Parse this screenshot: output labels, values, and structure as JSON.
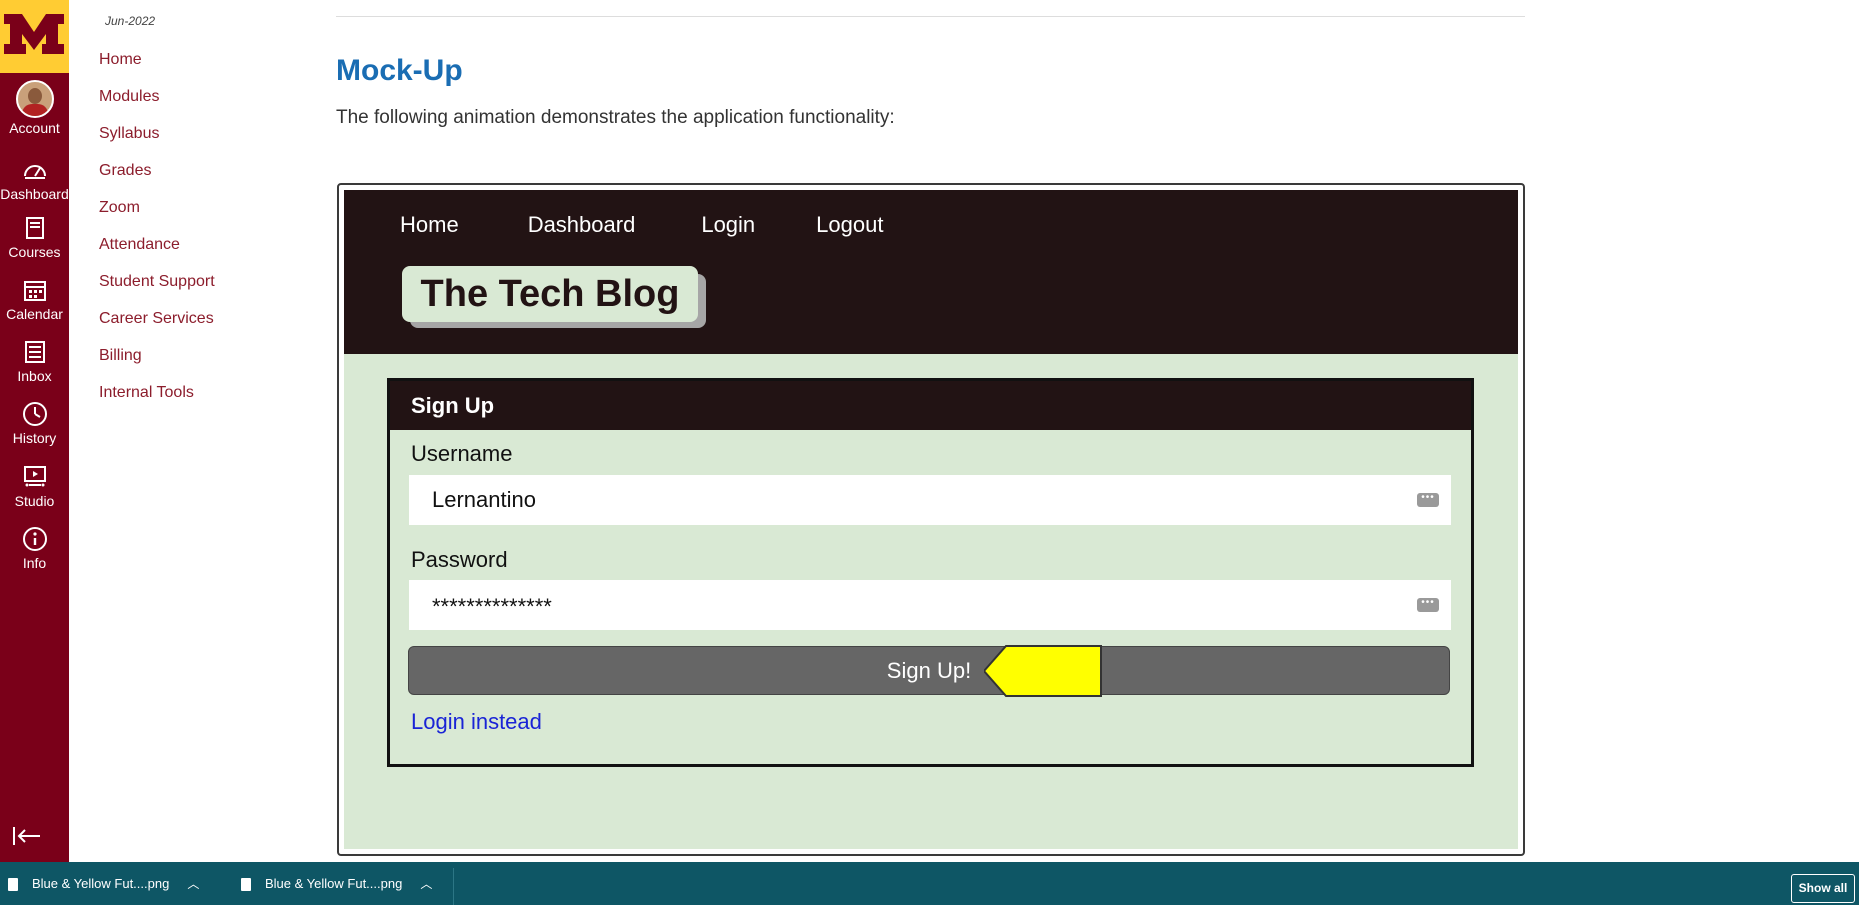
{
  "global_nav": {
    "items": [
      {
        "label": "Account",
        "icon": "avatar"
      },
      {
        "label": "Dashboard",
        "icon": "dashboard-icon"
      },
      {
        "label": "Courses",
        "icon": "courses-icon"
      },
      {
        "label": "Calendar",
        "icon": "calendar-icon"
      },
      {
        "label": "Inbox",
        "icon": "inbox-icon"
      },
      {
        "label": "History",
        "icon": "history-icon"
      },
      {
        "label": "Studio",
        "icon": "studio-icon"
      },
      {
        "label": "Info",
        "icon": "info-icon"
      }
    ],
    "colors": {
      "background": "#7a0019",
      "logo_bg": "#ffcc33"
    }
  },
  "course_nav": {
    "date": "Jun-2022",
    "items": [
      "Home",
      "Modules",
      "Syllabus",
      "Grades",
      "Zoom",
      "Attendance",
      "Student Support",
      "Career Services",
      "Billing",
      "Internal Tools"
    ]
  },
  "content": {
    "title": "Mock-Up",
    "intro": "The following animation demonstrates the application functionality:"
  },
  "mockup": {
    "nav": [
      "Home",
      "Dashboard",
      "Login",
      "Logout"
    ],
    "brand": "The Tech Blog",
    "form": {
      "header": "Sign Up",
      "username_label": "Username",
      "username_value": "Lernantino",
      "password_label": "Password",
      "password_value": "**************",
      "submit_label": "Sign Up!",
      "alt_link": "Login instead"
    },
    "colors": {
      "header_bg": "#221314",
      "body_bg": "#d9e9d4",
      "button_bg": "#666666",
      "pointer": "#ffff00"
    }
  },
  "downloads": {
    "items": [
      "Blue & Yellow Fut....png",
      "Blue & Yellow Fut....png"
    ],
    "show_all": "Show all"
  }
}
